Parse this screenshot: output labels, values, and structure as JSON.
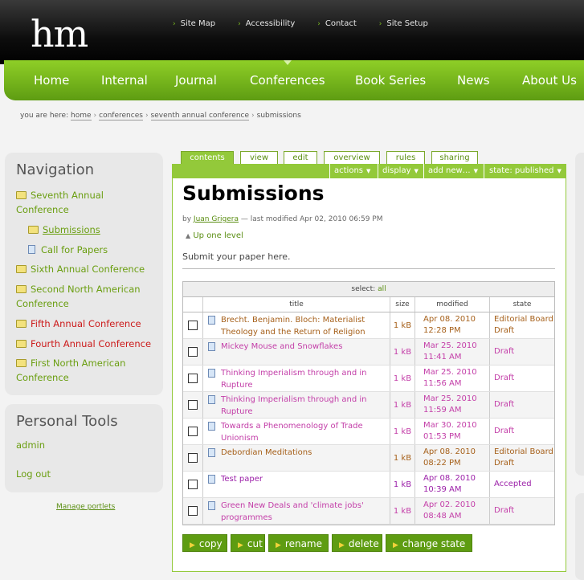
{
  "header": {
    "logo": "hm",
    "top_links": [
      "Site Map",
      "Accessibility",
      "Contact",
      "Site Setup"
    ]
  },
  "main_nav": [
    "Home",
    "Internal",
    "Journal",
    "Conferences",
    "Book Series",
    "News",
    "About Us"
  ],
  "breadcrumb": {
    "prefix": "you are here:",
    "items": [
      "home",
      "conferences",
      "seventh annual conference"
    ],
    "current": "submissions",
    "separator": "›"
  },
  "navigation": {
    "title": "Navigation",
    "items": [
      {
        "label": "Seventh Annual Conference",
        "label_line1": "Seventh Annual",
        "label_line2": "Conference",
        "icon": "folder-icon"
      },
      {
        "label": "Submissions",
        "icon": "folder-icon"
      },
      {
        "label": "Call for Papers",
        "icon": "document-icon"
      },
      {
        "label": "Sixth Annual Conference",
        "icon": "folder-icon"
      },
      {
        "label": "Second North American Conference",
        "label_line1": "Second North American",
        "label_line2": "Conference",
        "icon": "folder-icon"
      },
      {
        "label": "Fifth Annual Conference",
        "icon": "folder-icon"
      },
      {
        "label": "Fourth Annual Conference",
        "icon": "folder-icon"
      },
      {
        "label": "First North American Conference",
        "label_line1": "First North American",
        "label_line2": "Conference",
        "icon": "folder-icon"
      }
    ]
  },
  "personal_tools": {
    "title": "Personal Tools",
    "items": [
      "admin",
      "Log out"
    ]
  },
  "manage_portlets": "Manage portlets",
  "tabs": [
    "contents",
    "view",
    "edit",
    "overview",
    "rules",
    "sharing"
  ],
  "actions": [
    "actions",
    "display",
    "add new…",
    "state: published"
  ],
  "page": {
    "title": "Submissions",
    "by": "by",
    "author": "Juan Grigera",
    "modified": "— last modified Apr 02, 2010 06:59 PM",
    "up_level": "Up one level",
    "description": "Submit your paper here."
  },
  "table": {
    "select_label": "select:",
    "select_all": "all",
    "headers": [
      "title",
      "size",
      "modified",
      "state"
    ],
    "rows": [
      {
        "title1": "Brecht. Benjamin. Bloch: Materialist",
        "title2": "Theology and the Return of Religion",
        "size": "1 kB",
        "date": "Apr 08. 2010",
        "time": "12:28 PM",
        "state1": "Editorial Board",
        "state2": "Draft",
        "state_kind": "editorial"
      },
      {
        "title1": "Mickey Mouse and Snowflakes",
        "title2": "",
        "size": "1 kB",
        "date": "Mar 25. 2010",
        "time": "11:41 AM",
        "state1": "Draft",
        "state2": "",
        "state_kind": "draft"
      },
      {
        "title1": "Thinking Imperialism through and in",
        "title2": "Rupture",
        "size": "1 kB",
        "date": "Mar 25. 2010",
        "time": "11:56 AM",
        "state1": "Draft",
        "state2": "",
        "state_kind": "draft"
      },
      {
        "title1": "Thinking Imperialism through and in",
        "title2": "Rupture",
        "size": "1 kB",
        "date": "Mar 25. 2010",
        "time": "11:59 AM",
        "state1": "Draft",
        "state2": "",
        "state_kind": "draft"
      },
      {
        "title1": "Towards a Phenomenology of Trade",
        "title2": "Unionism",
        "size": "1 kB",
        "date": "Mar 30. 2010",
        "time": "01:53 PM",
        "state1": "Draft",
        "state2": "",
        "state_kind": "draft"
      },
      {
        "title1": "Debordian Meditations",
        "title2": "",
        "size": "1 kB",
        "date": "Apr 08. 2010",
        "time": "08:22 PM",
        "state1": "Editorial Board",
        "state2": "Draft",
        "state_kind": "editorial"
      },
      {
        "title1": "Test paper",
        "title2": "",
        "size": "1 kB",
        "date": "Apr 08. 2010",
        "time": "10:39 AM",
        "state1": "Accepted",
        "state2": "",
        "state_kind": "accepted"
      },
      {
        "title1": "Green New Deals and 'climate jobs'",
        "title2": "programmes",
        "size": "1 kB",
        "date": "Apr 02. 2010",
        "time": "08:48 AM",
        "state1": "Draft",
        "state2": "",
        "state_kind": "draft"
      }
    ]
  },
  "buttons": [
    "copy",
    "cut",
    "rename",
    "delete",
    "change state"
  ],
  "colors": {
    "accent_green": "#93c93a",
    "nav_green": "#6aa81a",
    "draft": "#c33ea8",
    "editorial": "#a6601a",
    "accepted": "#9b1fa8"
  }
}
